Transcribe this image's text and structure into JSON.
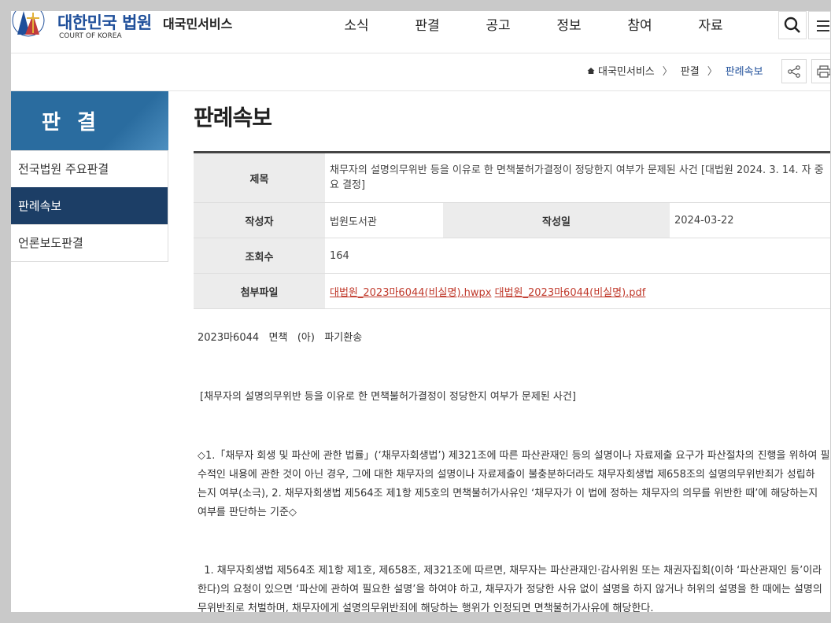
{
  "header": {
    "emblem_text": "대한민국법원",
    "logo_title": "대한민국 법원",
    "logo_sub": "COURT OF KOREA",
    "site_name": "대국민서비스",
    "nav": [
      "소식",
      "판결",
      "공고",
      "정보",
      "참여",
      "자료"
    ]
  },
  "breadcrumb": [
    "대국민서비스",
    "판결",
    "판례속보"
  ],
  "sidebar": {
    "title": "판 결",
    "items": [
      "전국법원 주요판결",
      "판례속보",
      "언론보도판결"
    ],
    "active_index": 1
  },
  "page_title": "판례속보",
  "info": {
    "title_label": "제목",
    "title_value": "채무자의 설명의무위반 등을 이유로 한 면책불허가결정이 정당한지 여부가 문제된 사건 [대법원 2024. 3. 14. 자 중요 결정]",
    "author_label": "작성자",
    "author_value": "법원도서관",
    "date_label": "작성일",
    "date_value": "2024-03-22",
    "views_label": "조회수",
    "views_value": "164",
    "attach_label": "첨부파일",
    "attachments": [
      "대법원_2023마6044(비실명).hwpx",
      "대법원_2023마6044(비실명).pdf"
    ]
  },
  "body": {
    "case_line": "2023마6044   면책   (아)   파기환송",
    "summary": "[채무자의 설명의무위반 등을 이유로 한 면책불허가결정이 정당한지 여부가 문제된 사건]",
    "issue_lines": [
      "◇1.「채무자 회생 및 파산에 관한 법률」(‘채무자회생법’) 제321조에 따른 파산관재인 등의 설명이나 자료제출 요구가 파산절차의 진행을 위하여 필",
      "수적인 내용에 관한 것이 아닌 경우, 그에 대한 채무자의 설명이나 자료제출이 불충분하더라도 채무자회생법 제658조의 설명의무위반죄가 성립하",
      "는지 여부(소극), 2. 채무자회생법 제564조 제1항 제5호의 면책불허가사유인 ‘채무자가 이 법에 정하는 채무자의 의무를 위반한 때’에 해당하는지",
      "여부를 판단하는 기준◇"
    ],
    "para_lines": [
      "  1. 채무자회생법 제564조 제1항 제1호, 제658조, 제321조에 따르면, 채무자는 파산관재인·감사위원 또는 채권자집회(이하 ‘파산관재인 등’이라",
      "한다)의 요청이 있으면 ‘파산에 관하여 필요한 설명’을 하여야 하고, 채무자가 정당한 사유 없이 설명을 하지 않거나 허위의 설명을 한 때에는 설명의",
      "무위반죄로 처벌하며, 채무자에게 설명의무위반죄에 해당하는 행위가 인정되면 면책불허가사유에 해당한다."
    ]
  }
}
